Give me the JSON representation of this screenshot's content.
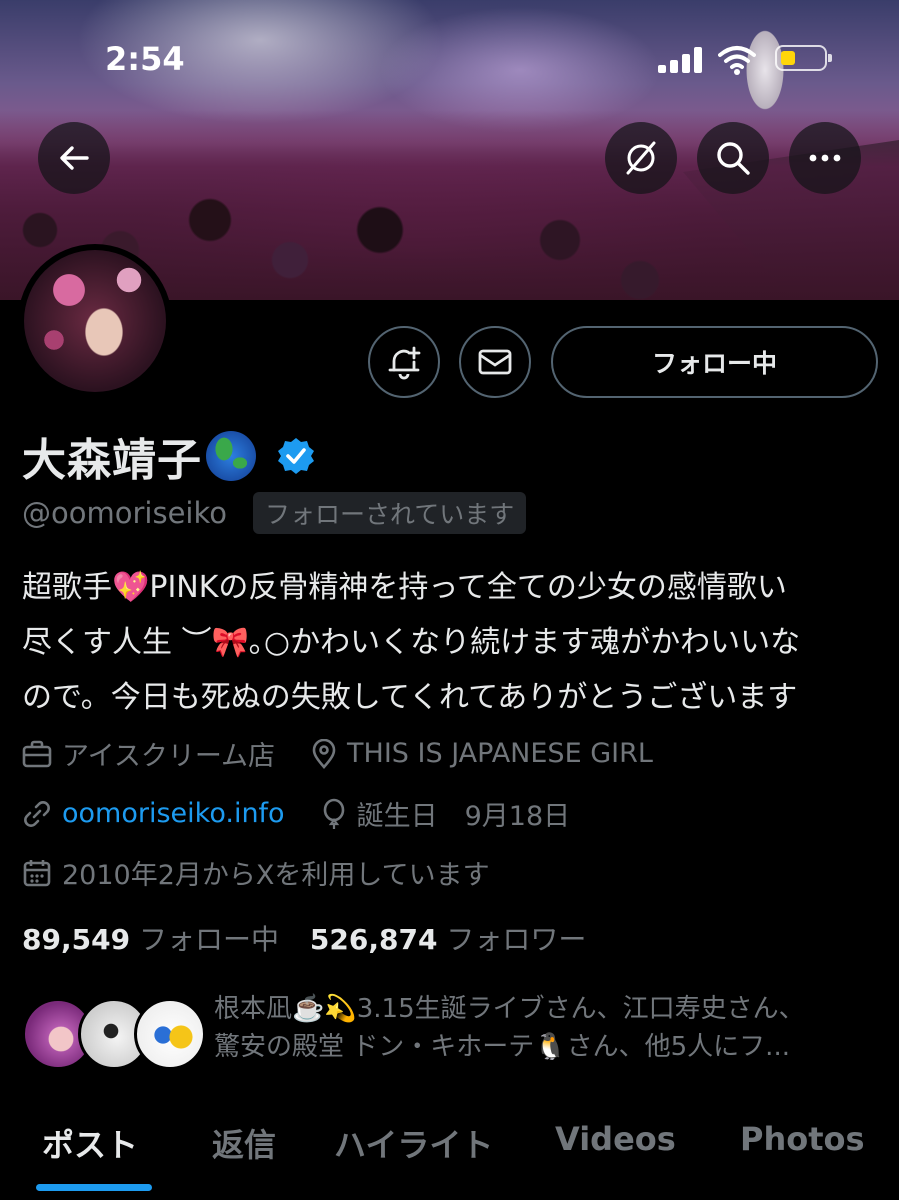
{
  "status_bar": {
    "time": "2:54"
  },
  "profile": {
    "name": "大森靖子",
    "handle": "@oomoriseiko",
    "follows_you": "フォローされています",
    "follow_button": "フォロー中",
    "bio_lines": [
      "超歌手💖PINKの反骨精神を持って全ての少女の感情歌い",
      "尽くす人生 ︶🎀｡○かわいくなり続けます魂がかわいいな",
      "ので。今日も死ぬの失敗してくれてありがとうございます"
    ],
    "category": "アイスクリーム店",
    "location": "THIS IS JAPANESE GIRL",
    "website": "oomoriseiko.info",
    "birthday": "誕生日　9月18日",
    "joined": "2010年2月からXを利用しています",
    "following_count": "89,549",
    "following_label": "フォロー中",
    "followers_count": "526,874",
    "followers_label": "フォロワー",
    "followed_by_lines": [
      "根本凪☕️💫3.15生誕ライブさん、江口寿史さん、",
      "驚安の殿堂 ドン・キホーテ🐧さん、他5人にフ..."
    ]
  },
  "tabs": [
    "ポスト",
    "返信",
    "ハイライト",
    "Videos",
    "Photos"
  ],
  "active_tab": "ポスト",
  "icons": {
    "back": "arrow-left-icon",
    "grok": "grok-icon",
    "search": "search-icon",
    "more": "more-icon",
    "notify": "bell-plus-icon",
    "message": "envelope-icon",
    "verified": "verified-badge-icon"
  },
  "colors": {
    "background": "#000000",
    "text": "#e7e9ea",
    "muted": "#71767b",
    "accent": "#1d9bf0"
  }
}
